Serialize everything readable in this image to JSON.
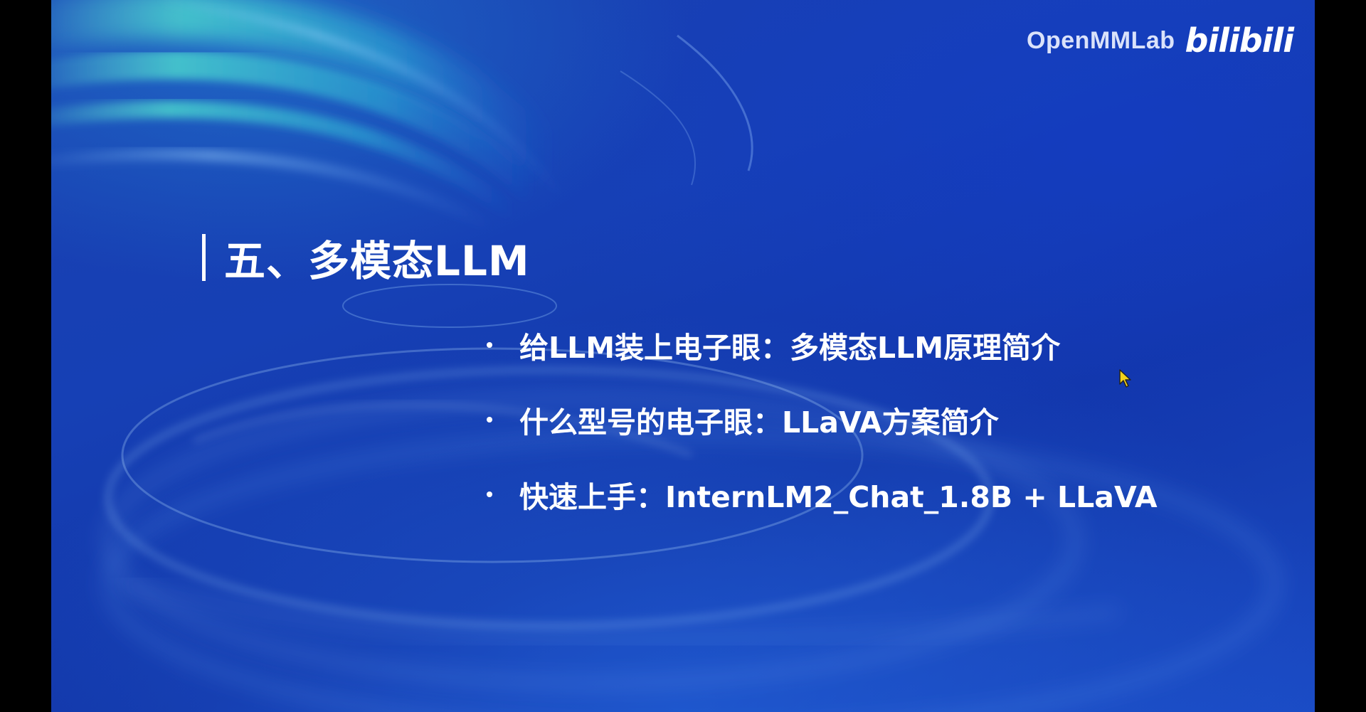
{
  "brand": {
    "name": "OpenMMLab",
    "logo_text": "bilibili"
  },
  "section": {
    "title": "五、多模态LLM"
  },
  "bullets": [
    {
      "text": "给LLM装上电子眼：多模态LLM原理简介"
    },
    {
      "text": "什么型号的电子眼：LLaVA方案简介"
    },
    {
      "text": "快速上手：InternLM2_Chat_1.8B + LLaVA"
    }
  ],
  "colors": {
    "background": "#1640b5",
    "letterbox": "#000000",
    "text": "#ffffff",
    "swirl_accent": "#35d3c8",
    "cursor": "#f2d21b"
  },
  "icons": {
    "cursor": "mouse-pointer-icon"
  }
}
